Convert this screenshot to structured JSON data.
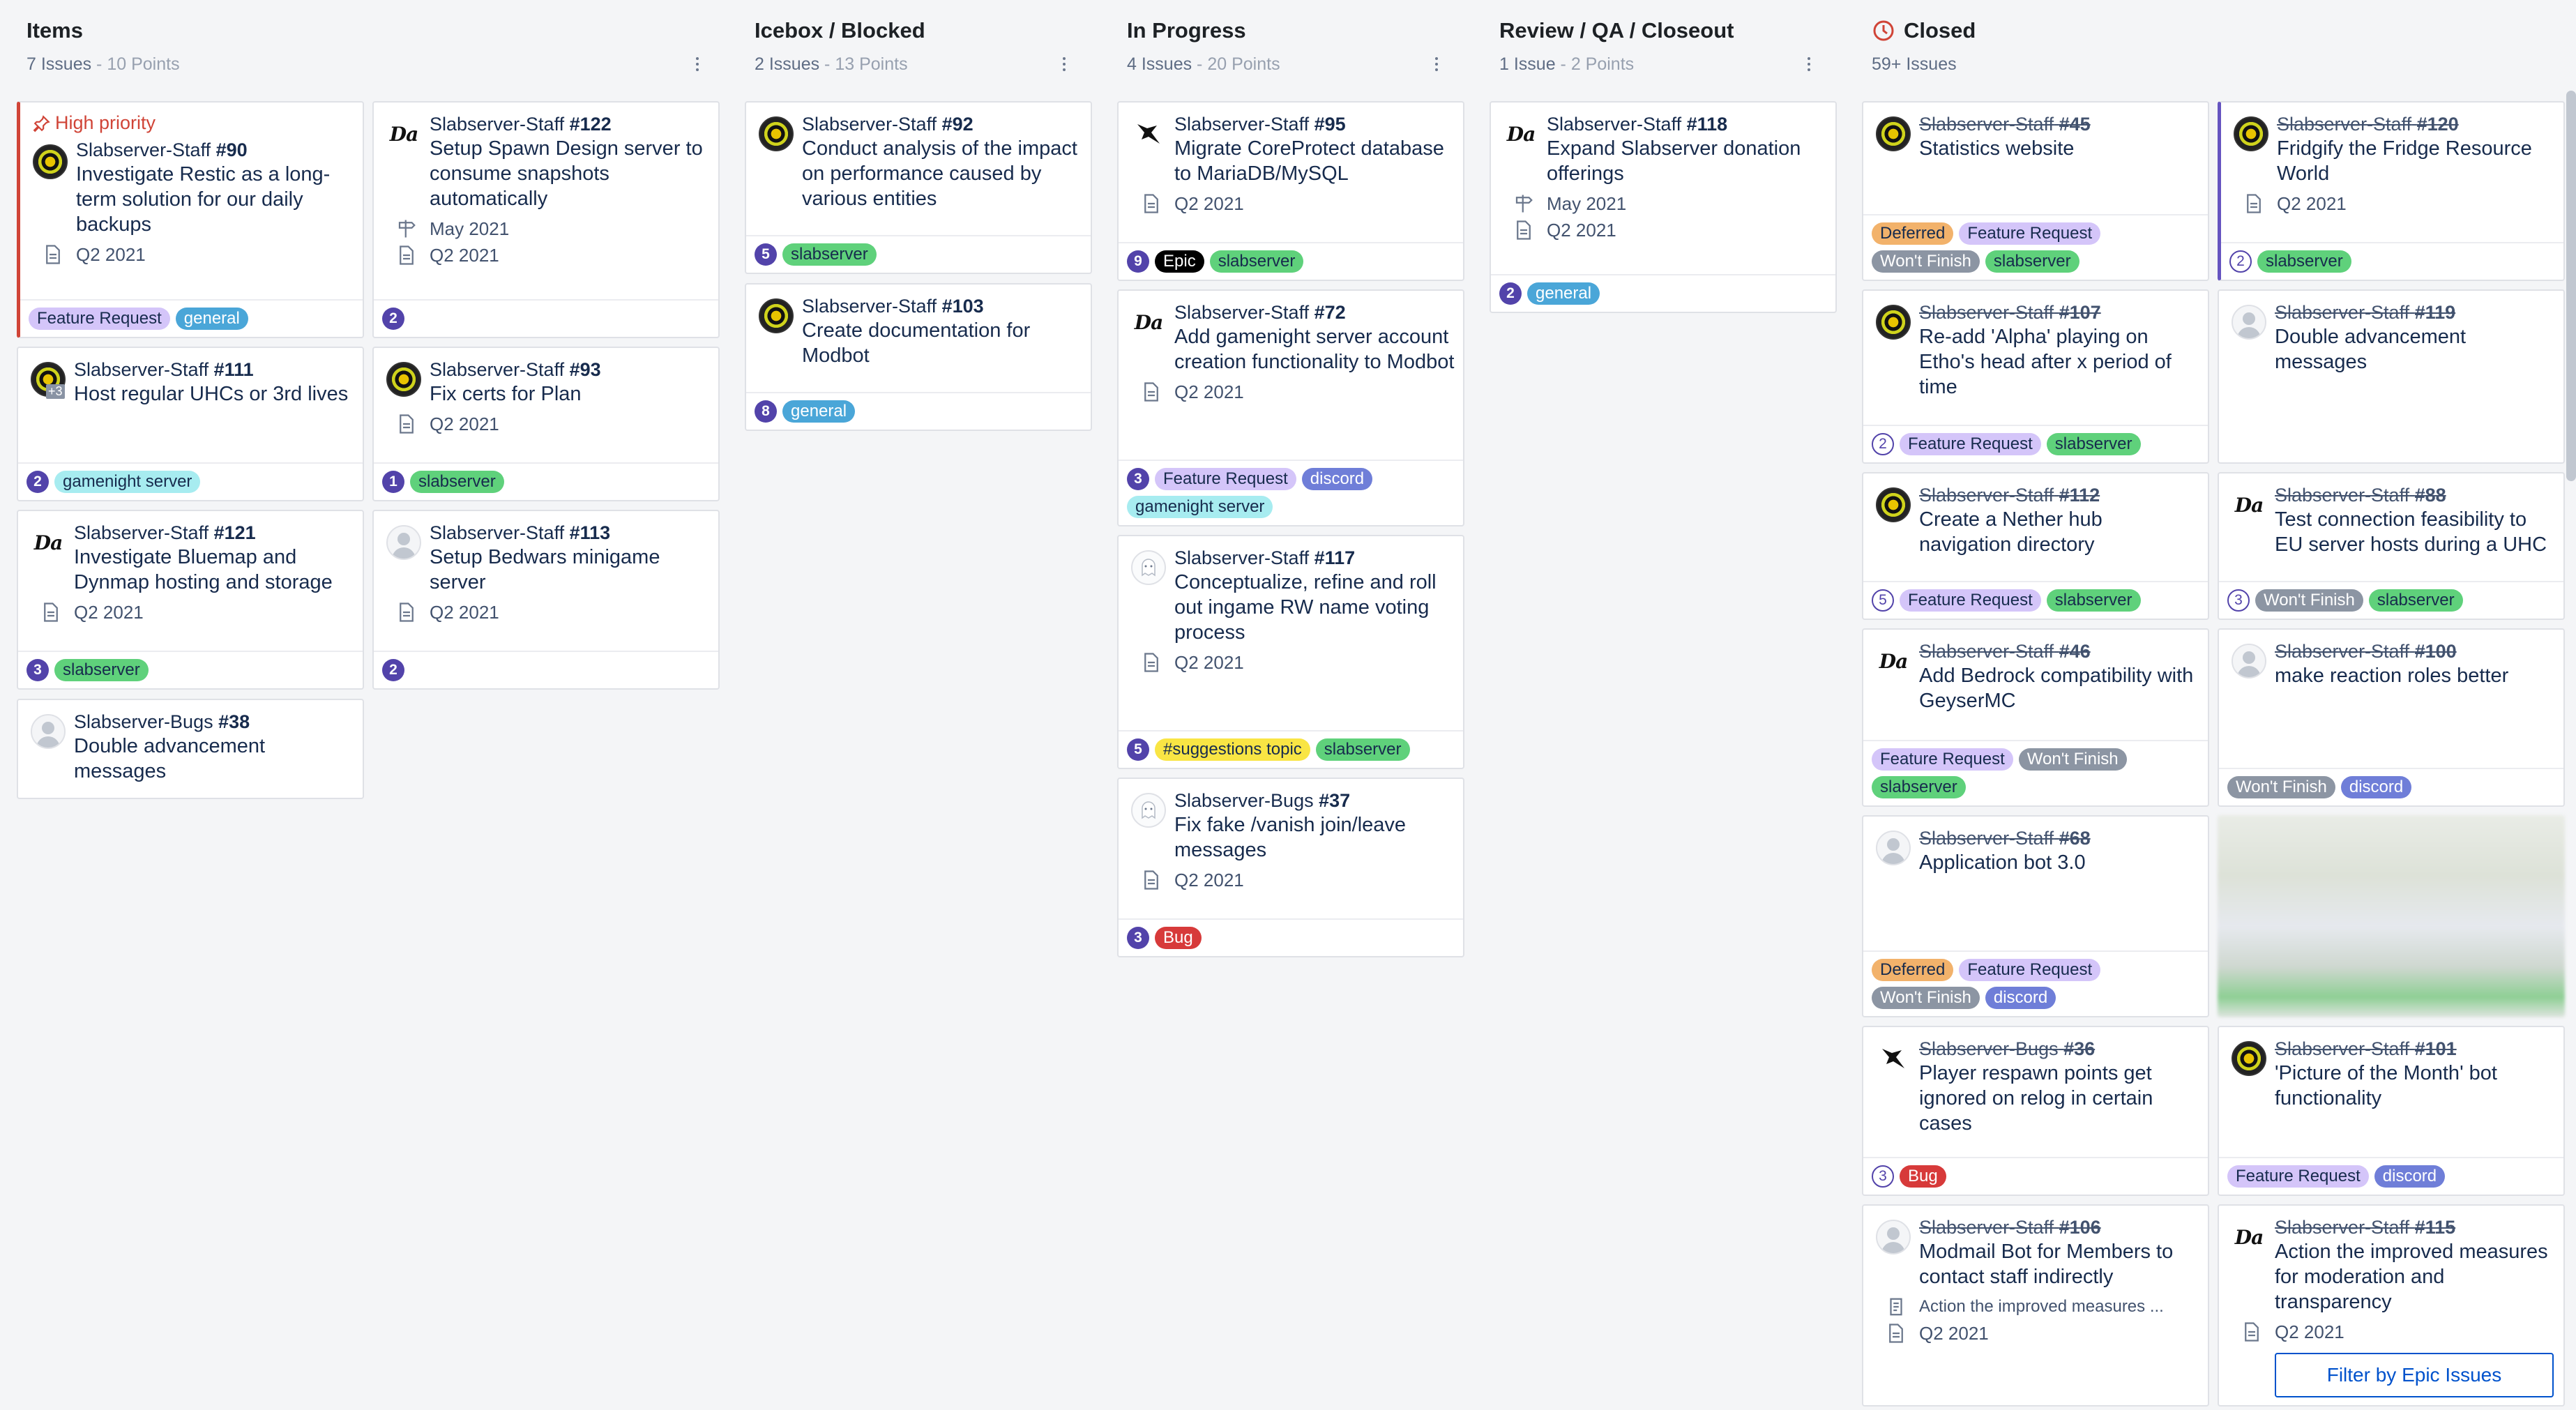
{
  "columns": [
    {
      "title": "Items",
      "issues": "7 Issues",
      "points": "10 Points"
    },
    {
      "title": "Icebox / Blocked",
      "issues": "2 Issues",
      "points": "13 Points"
    },
    {
      "title": "In Progress",
      "issues": "4 Issues",
      "points": "20 Points"
    },
    {
      "title": "Review / QA / Closeout",
      "issues": "1 Issue",
      "points": "2 Points"
    },
    {
      "title": "Closed",
      "issues": "59+ Issues",
      "points": ""
    }
  ],
  "separator": " - ",
  "high_priority_label": "High priority",
  "filter_button": "Filter by Epic Issues",
  "label_colors": {
    "Feature Request": "#d4c5f9",
    "general": "#4aa6d8",
    "gamenight server": "#a7ecf0",
    "slabserver": "#5fd17b",
    "Epic": "#000000",
    "discord": "#6f7ed8",
    "#suggestions topic": "#f9e544",
    "Bug": "#d73a3a",
    "Deferred": "#f2b26b",
    "Won't Finish": "#8c95a3"
  },
  "cards": [
    {
      "repo": "Slabserver-Staff",
      "num": "#90",
      "title": "Investigate Restic as a long-term solution for our daily backups",
      "meta": [
        {
          "icon": "doc-icon",
          "text": "Q2 2021"
        }
      ],
      "est": "",
      "labels": [
        "Feature Request",
        "general"
      ]
    },
    {
      "repo": "Slabserver-Staff",
      "num": "#111",
      "title": "Host regular UHCs or 3rd lives",
      "meta": [],
      "est": "2",
      "labels": [
        "gamenight server"
      ],
      "plus": "+3"
    },
    {
      "repo": "Slabserver-Staff",
      "num": "#121",
      "title": "Investigate Bluemap and Dynmap hosting and storage",
      "meta": [
        {
          "icon": "doc-icon",
          "text": "Q2 2021"
        }
      ],
      "est": "3",
      "labels": [
        "slabserver"
      ]
    },
    {
      "repo": "Slabserver-Bugs",
      "num": "#38",
      "title": "Double advancement messages",
      "meta": [],
      "est": "",
      "labels": []
    },
    {
      "repo": "Slabserver-Staff",
      "num": "#122",
      "title": "Setup Spawn Design server to consume snapshots automatically",
      "meta": [
        {
          "icon": "milestone-icon",
          "text": "May 2021"
        },
        {
          "icon": "doc-icon",
          "text": "Q2 2021"
        }
      ],
      "est": "2",
      "labels": []
    },
    {
      "repo": "Slabserver-Staff",
      "num": "#93",
      "title": "Fix certs for Plan",
      "meta": [
        {
          "icon": "doc-icon",
          "text": "Q2 2021"
        }
      ],
      "est": "1",
      "labels": [
        "slabserver"
      ]
    },
    {
      "repo": "Slabserver-Staff",
      "num": "#113",
      "title": "Setup Bedwars minigame server",
      "meta": [
        {
          "icon": "doc-icon",
          "text": "Q2 2021"
        }
      ],
      "est": "2",
      "labels": []
    },
    {
      "repo": "Slabserver-Staff",
      "num": "#92",
      "title": "Conduct analysis of the impact on performance caused by various entities",
      "meta": [],
      "est": "5",
      "labels": [
        "slabserver"
      ]
    },
    {
      "repo": "Slabserver-Staff",
      "num": "#103",
      "title": "Create documentation for Modbot",
      "meta": [],
      "est": "8",
      "labels": [
        "general"
      ]
    },
    {
      "repo": "Slabserver-Staff",
      "num": "#95",
      "title": "Migrate CoreProtect database to MariaDB/MySQL",
      "meta": [
        {
          "icon": "doc-icon",
          "text": "Q2 2021"
        }
      ],
      "est": "9",
      "labels": [
        "Epic",
        "slabserver"
      ]
    },
    {
      "repo": "Slabserver-Staff",
      "num": "#72",
      "title": "Add gamenight server account creation functionality to Modbot",
      "meta": [
        {
          "icon": "doc-icon",
          "text": "Q2 2021"
        }
      ],
      "est": "3",
      "labels": [
        "Feature Request",
        "discord",
        "gamenight server"
      ]
    },
    {
      "repo": "Slabserver-Staff",
      "num": "#117",
      "title": "Conceptualize, refine and roll out ingame RW name voting process",
      "meta": [
        {
          "icon": "doc-icon",
          "text": "Q2 2021"
        }
      ],
      "est": "5",
      "labels": [
        "#suggestions topic",
        "slabserver"
      ]
    },
    {
      "repo": "Slabserver-Bugs",
      "num": "#37",
      "title": "Fix fake /vanish join/leave messages",
      "meta": [
        {
          "icon": "doc-icon",
          "text": "Q2 2021"
        }
      ],
      "est": "3",
      "labels": [
        "Bug"
      ]
    },
    {
      "repo": "Slabserver-Staff",
      "num": "#118",
      "title": "Expand Slabserver donation offerings",
      "meta": [
        {
          "icon": "milestone-icon",
          "text": "May 2021"
        },
        {
          "icon": "doc-icon",
          "text": "Q2 2021"
        }
      ],
      "est": "2",
      "labels": [
        "general"
      ]
    },
    {
      "repo": "Slabserver-Staff",
      "num": "#45",
      "title": "Statistics website",
      "meta": [],
      "est": "",
      "labels": [
        "Deferred",
        "Feature Request",
        "Won't Finish",
        "slabserver"
      ]
    },
    {
      "repo": "Slabserver-Staff",
      "num": "#107",
      "title": "Re-add 'Alpha' playing on Etho's head after x period of time",
      "meta": [],
      "est": "2",
      "labels": [
        "Feature Request",
        "slabserver"
      ]
    },
    {
      "repo": "Slabserver-Staff",
      "num": "#112",
      "title": "Create a Nether hub navigation directory",
      "meta": [],
      "est": "5",
      "labels": [
        "Feature Request",
        "slabserver"
      ]
    },
    {
      "repo": "Slabserver-Staff",
      "num": "#46",
      "title": "Add Bedrock compatibility with GeyserMC",
      "meta": [],
      "est": "",
      "labels": [
        "Feature Request",
        "Won't Finish",
        "slabserver"
      ]
    },
    {
      "repo": "Slabserver-Staff",
      "num": "#68",
      "title": "Application bot 3.0",
      "meta": [],
      "est": "",
      "labels": [
        "Deferred",
        "Feature Request",
        "Won't Finish",
        "discord"
      ]
    },
    {
      "repo": "Slabserver-Bugs",
      "num": "#36",
      "title": "Player respawn points get ignored on relog in certain cases",
      "meta": [],
      "est": "3",
      "labels": [
        "Bug"
      ]
    },
    {
      "repo": "Slabserver-Staff",
      "num": "#106",
      "title": "Modmail Bot for Members to contact staff indirectly",
      "meta": [
        {
          "icon": "list-icon",
          "text": "Action the improved measures ..."
        },
        {
          "icon": "doc-icon",
          "text": "Q2 2021"
        }
      ],
      "est": "",
      "labels": []
    },
    {
      "repo": "Slabserver-Staff",
      "num": "#120",
      "title": "Fridgify the Fridge Resource World",
      "meta": [
        {
          "icon": "doc-icon",
          "text": "Q2 2021"
        }
      ],
      "est": "2",
      "labels": [
        "slabserver"
      ]
    },
    {
      "repo": "Slabserver-Staff",
      "num": "#119",
      "title": "Double advancement messages",
      "meta": [],
      "est": "",
      "labels": []
    },
    {
      "repo": "Slabserver-Staff",
      "num": "#88",
      "title": "Test connection feasibility to EU server hosts during a UHC",
      "meta": [],
      "est": "3",
      "labels": [
        "Won't Finish",
        "slabserver"
      ]
    },
    {
      "repo": "Slabserver-Staff",
      "num": "#100",
      "title": "make reaction roles better",
      "meta": [],
      "est": "",
      "labels": [
        "Won't Finish",
        "discord"
      ]
    },
    {
      "repo": "Slabserver-Staff",
      "num": "#101",
      "title": "'Picture of the Month' bot functionality",
      "meta": [],
      "est": "",
      "labels": [
        "Feature Request",
        "discord"
      ]
    },
    {
      "repo": "Slabserver-Staff",
      "num": "#115",
      "title": "Action the improved measures for moderation and transparency",
      "meta": [
        {
          "icon": "doc-icon",
          "text": "Q2 2021"
        }
      ],
      "est": "",
      "labels": []
    }
  ]
}
